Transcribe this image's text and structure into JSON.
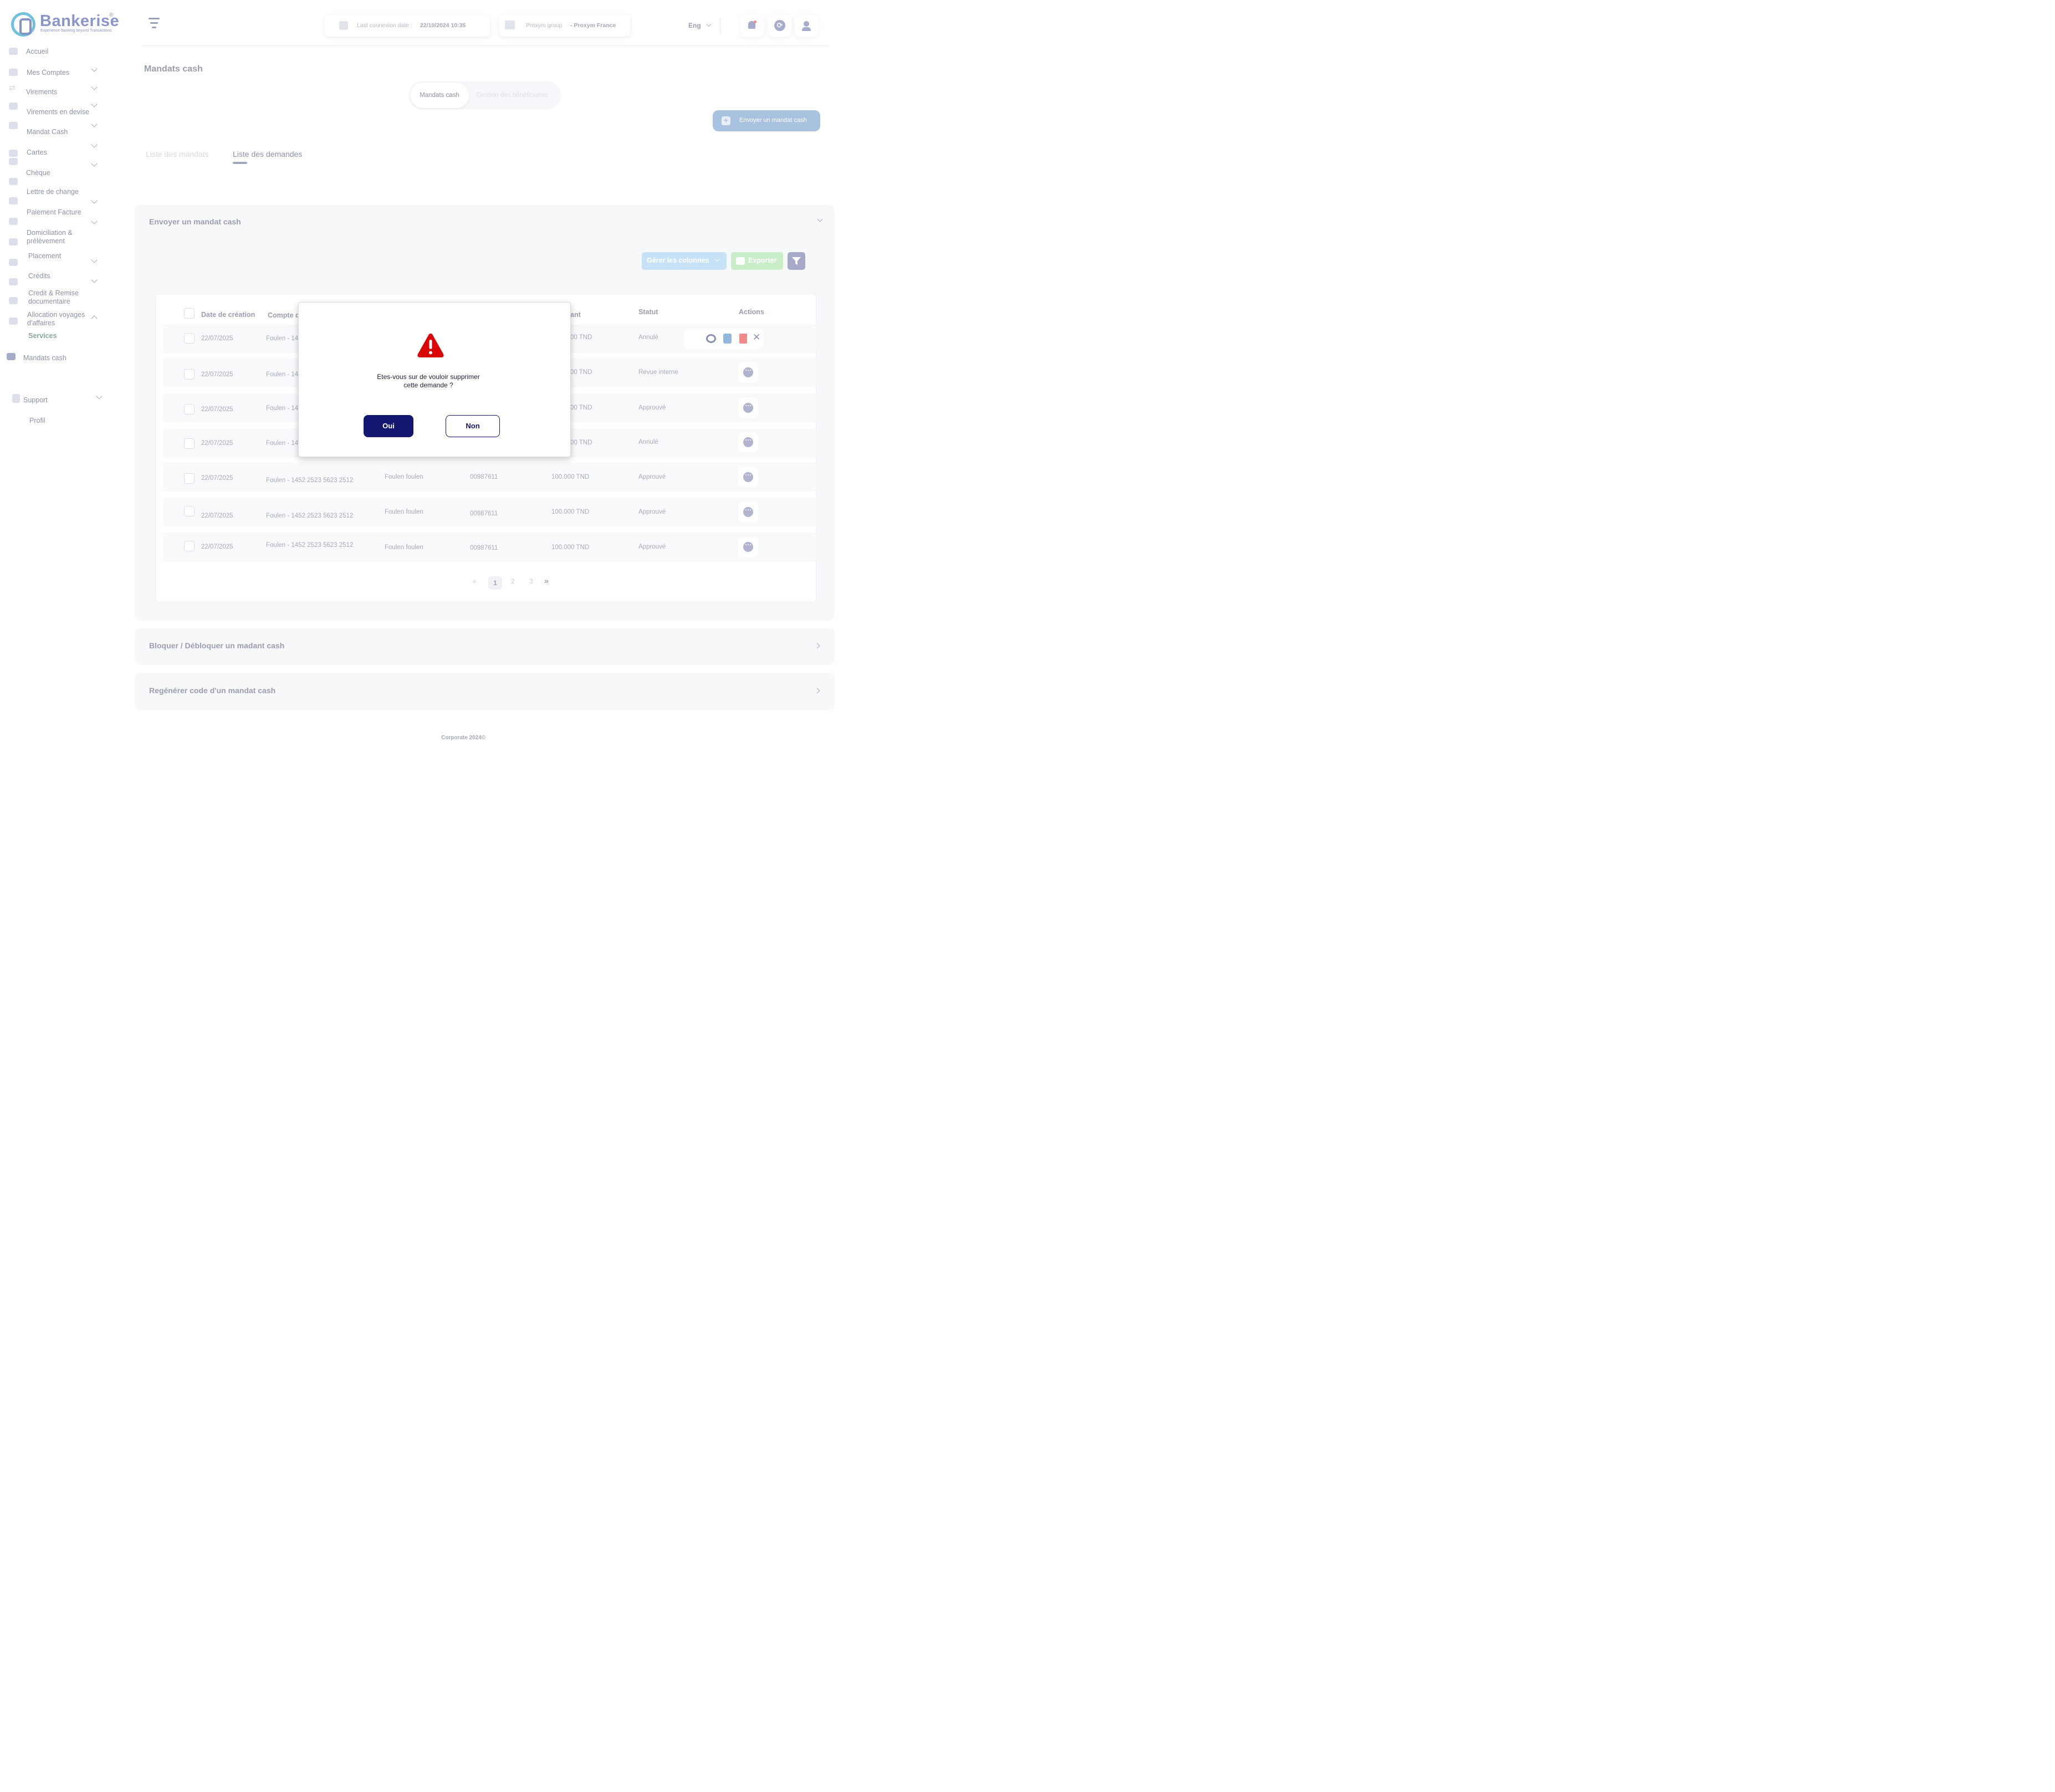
{
  "brand": {
    "name": "Bankerise",
    "tagline": "Experience Banking beyond Transactions",
    "reg": "®"
  },
  "sidebar": {
    "items": [
      {
        "label": "Accueil"
      },
      {
        "label": "Mes Comptes"
      },
      {
        "label": "Virements"
      },
      {
        "label": "Virements en devise"
      },
      {
        "label": "Mandat Cash"
      },
      {
        "label": "Cartes"
      },
      {
        "label": "Chèque"
      },
      {
        "label": "Lettre de change"
      },
      {
        "label": "Paiement Facture"
      },
      {
        "label": "Domiciliation & prélèvement"
      },
      {
        "label": "Placement"
      },
      {
        "label": "Crédits"
      },
      {
        "label": "Credit & Remise documentaire"
      },
      {
        "label": "Allocation  voyages d'affaires"
      },
      {
        "label": "Services"
      },
      {
        "label": "Mandats cash"
      },
      {
        "label": "Support"
      },
      {
        "label": "Profil"
      }
    ]
  },
  "header": {
    "last_connexion_label": "Last connexion date :",
    "last_connexion_value": "22/10/2024 10:35",
    "group_label": "Proxym group",
    "group_value": "- Proxym France",
    "lang": "Eng"
  },
  "page": {
    "title": "Mandats cash",
    "segments": [
      "Mandats cash",
      "Gestion des bénéficiaires"
    ],
    "send_button": "Envoyer un mandat cash",
    "tabs": [
      "Liste des mandats",
      "Liste des demandes"
    ]
  },
  "panel": {
    "title": "Envoyer un mandat cash",
    "manage_columns": "Gérer les colonnes",
    "export": "Exporter"
  },
  "table": {
    "headers": [
      "Date de création",
      "Compte d",
      "ant",
      "Statut",
      "Actions"
    ],
    "rows": [
      {
        "date": "22/07/2025",
        "compte": "Foulen - 14",
        "montant": "00 TND",
        "statut": "Annulé"
      },
      {
        "date": "22/07/2025",
        "compte": "Foulen - 14",
        "montant": "00 TND",
        "statut": "Revue interne"
      },
      {
        "date": "22/07/2025",
        "compte": "Foulen - 14",
        "montant": "00 TND",
        "statut": "Approuvé"
      },
      {
        "date": "22/07/2025",
        "compte": "Foulen - 14",
        "montant": "00 TND",
        "statut": "Annulé"
      },
      {
        "date": "22/07/2025",
        "compte": "Foulen - 1452 2523 5623 2512",
        "beneficiaire": "Foulen foulen",
        "code": "00987611",
        "montant": "100.000 TND",
        "statut": "Approuvé"
      },
      {
        "date": "22/07/2025",
        "compte": "Foulen - 1452 2523 5623 2512",
        "beneficiaire": "Foulen foulen",
        "code": "00987611",
        "montant": "100.000 TND",
        "statut": "Approuvé"
      },
      {
        "date": "22/07/2025",
        "compte": "Foulen - 1452 2523 5623 2512",
        "beneficiaire": "Foulen foulen",
        "code": "00987611",
        "montant": "100.000 TND",
        "statut": "Approuvé"
      }
    ]
  },
  "pagination": {
    "prev": "«",
    "pages": [
      "1",
      "2",
      "3"
    ],
    "next": "»"
  },
  "accordions": [
    "Bloquer / Débloquer un madant cash",
    "Regénérer code d'un mandat cash"
  ],
  "footer": "Corporate 2024©",
  "modal": {
    "message_line1": "Etes-vous sur de vouloir  supprimer",
    "message_line2": "cette demande  ?",
    "yes": "Oui",
    "no": "Non",
    "icon_color": "#d90606"
  }
}
